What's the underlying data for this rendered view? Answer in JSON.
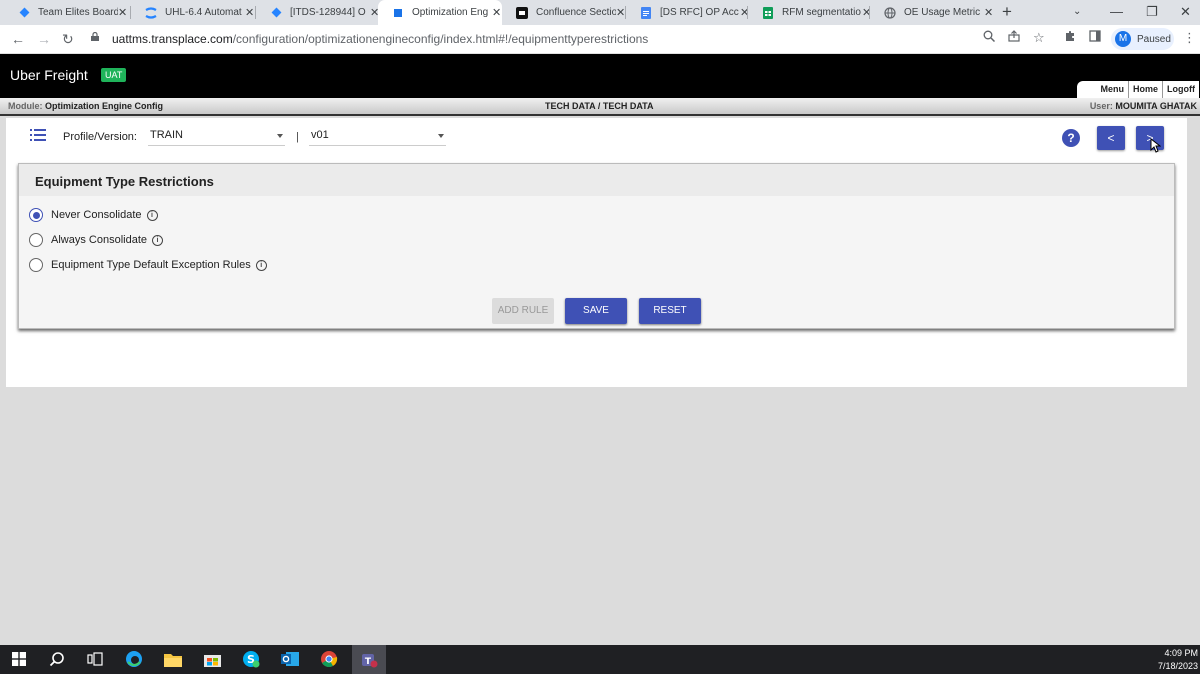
{
  "browser": {
    "tabs": [
      {
        "title": "Team Elites Board",
        "icon": "jira-icon",
        "color": "#2684ff"
      },
      {
        "title": "UHL-6.4 Automat",
        "icon": "confluence-icon",
        "color": "#2684ff"
      },
      {
        "title": "[ITDS-128944] O",
        "icon": "jira-icon",
        "color": "#2684ff"
      },
      {
        "title": "Optimization Eng",
        "icon": "page-icon",
        "color": "#1a73e8",
        "active": true
      },
      {
        "title": "Confluence Sectio",
        "icon": "confluence-icon",
        "color": "#000000"
      },
      {
        "title": "[DS RFC] OP Acc",
        "icon": "docs-icon",
        "color": "#4285f4"
      },
      {
        "title": "RFM segmentatio",
        "icon": "sheets-icon",
        "color": "#0f9d58"
      },
      {
        "title": "OE Usage Metric",
        "icon": "globe-icon",
        "color": "#5f6368"
      }
    ],
    "url_domain": "uattms.transplace.com",
    "url_path": "/configuration/optimizationengineconfig/index.html#!/equipmenttyperestrictions",
    "profile_initial": "M",
    "profile_status": "Paused"
  },
  "app": {
    "brand": "Uber Freight",
    "env_badge": "UAT",
    "top_menu": [
      "Menu",
      "Home",
      "Logoff"
    ],
    "module_label": "Module:",
    "module_name": "Optimization Engine Config",
    "center_title": "TECH DATA / TECH DATA",
    "user_label": "User:",
    "user_name": "MOUMITA GHATAK"
  },
  "toolbar": {
    "profile_version_label": "Profile/Version:",
    "profile_value": "TRAIN",
    "separator": "|",
    "version_value": "v01",
    "help_label": "?",
    "prev_label": "<",
    "next_label": ">"
  },
  "card": {
    "title": "Equipment Type Restrictions",
    "options": [
      {
        "label": "Never Consolidate",
        "selected": true
      },
      {
        "label": "Always Consolidate",
        "selected": false
      },
      {
        "label": "Equipment Type Default Exception Rules",
        "selected": false
      }
    ],
    "info_glyph": "i",
    "add_rule_label": "ADD RULE",
    "save_label": "SAVE",
    "reset_label": "RESET"
  },
  "taskbar": {
    "time": "4:09 PM",
    "date": "7/18/2023"
  },
  "colors": {
    "accent": "#3f51b5",
    "uat_badge": "#1fb35a"
  }
}
